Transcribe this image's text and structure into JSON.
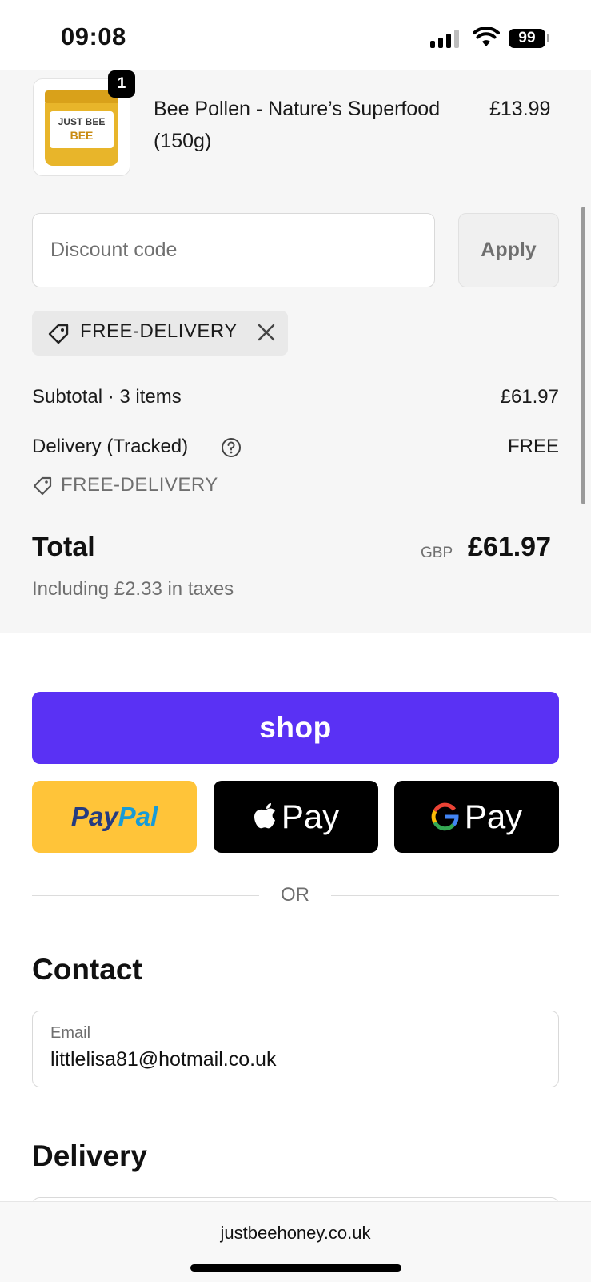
{
  "status_bar": {
    "time": "09:08",
    "battery": "99"
  },
  "cart_item": {
    "quantity": "1",
    "name": "Bee Pollen - Nature’s Superfood (150g)",
    "price": "£13.99",
    "image_brand": "JUST BEE",
    "image_product": "BEE"
  },
  "discount": {
    "placeholder": "Discount code",
    "apply_label": "Apply",
    "applied_code": "FREE-DELIVERY"
  },
  "summary": {
    "subtotal_label": "Subtotal · 3 items",
    "subtotal_value": "£61.97",
    "delivery_label": "Delivery (Tracked)",
    "delivery_value": "FREE",
    "delivery_discount_code": "FREE-DELIVERY",
    "total_label": "Total",
    "currency": "GBP",
    "total_value": "£61.97",
    "taxes_note": "Including £2.33 in taxes"
  },
  "express_checkout": {
    "shop_label": "shop",
    "paypal_pay": "Pay",
    "paypal_pal": "Pal",
    "apple_pay_label": "Pay",
    "google_pay_label": "Pay",
    "or_label": "OR"
  },
  "contact": {
    "title": "Contact",
    "email_label": "Email",
    "email_value": "littlelisa81@hotmail.co.uk"
  },
  "delivery_section": {
    "title": "Delivery"
  },
  "browser": {
    "url": "justbeehoney.co.uk"
  },
  "colors": {
    "shop_purple": "#5a31f4",
    "paypal_yellow": "#ffc439",
    "summary_bg": "#f6f6f6"
  }
}
